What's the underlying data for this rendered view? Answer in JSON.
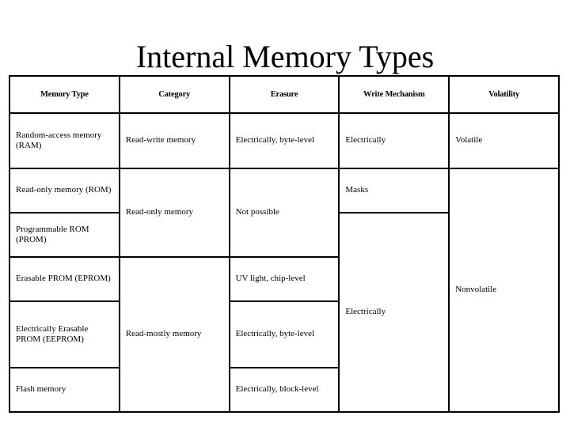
{
  "slide": {
    "title": "Internal Memory Types",
    "background_color": "#ffffff",
    "text_color": "#000000",
    "border_color": "#000000"
  },
  "table": {
    "headers": [
      "Memory Type",
      "Category",
      "Erasure",
      "Write Mechanism",
      "Volatility"
    ],
    "rows": {
      "ram": {
        "memory_type": "Random-access memory (RAM)",
        "category": "Read-write memory",
        "erasure": "Electrically, byte-level",
        "write_mechanism": "Electrically",
        "volatility": "Volatile"
      },
      "rom": {
        "memory_type": "Read-only memory (ROM)",
        "category": "Read-only memory",
        "erasure": "Not possible",
        "write_mechanism": "Masks",
        "volatility": "Nonvolatile"
      },
      "prom": {
        "memory_type": "Programmable ROM (PROM)",
        "write_mechanism": "Electrically"
      },
      "eprom": {
        "memory_type": "Erasable PROM (EPROM)",
        "category": "Read-mostly memory",
        "erasure": "UV light, chip-level"
      },
      "eeprom": {
        "memory_type": "Electrically Erasable PROM (EEPROM)",
        "erasure": "Electrically, byte-level"
      },
      "flash": {
        "memory_type": "Flash memory",
        "erasure": "Electrically, block-level"
      }
    }
  }
}
